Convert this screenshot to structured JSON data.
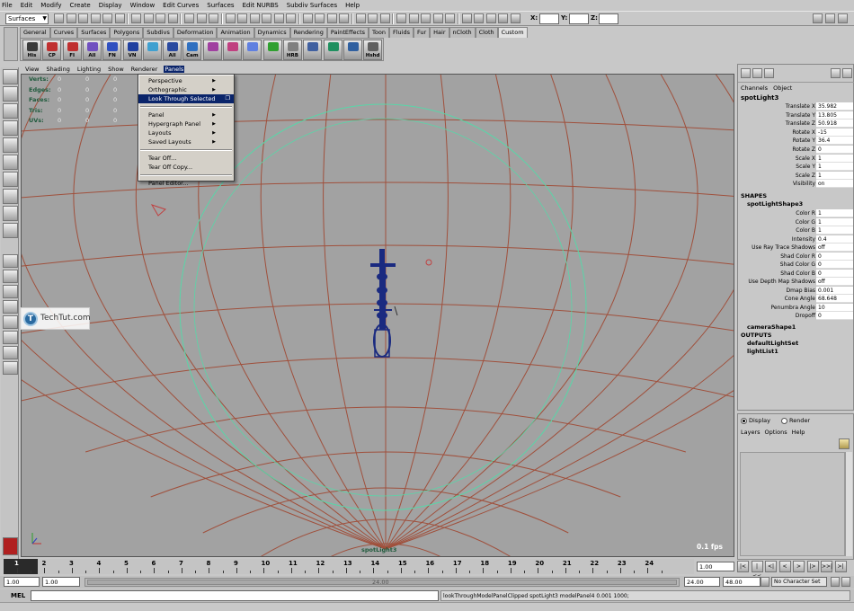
{
  "menubar": [
    "File",
    "Edit",
    "Modify",
    "Create",
    "Display",
    "Window",
    "Edit Curves",
    "Surfaces",
    "Edit NURBS",
    "Subdiv Surfaces",
    "Help"
  ],
  "status": {
    "mode": "Surfaces",
    "coord_labels": [
      "X:",
      "Y:",
      "Z:"
    ]
  },
  "shelf": {
    "tabs": [
      "General",
      "Curves",
      "Surfaces",
      "Polygons",
      "Subdivs",
      "Deformation",
      "Animation",
      "Dynamics",
      "Rendering",
      "PaintEffects",
      "Toon",
      "Fluids",
      "Fur",
      "Hair",
      "nCloth",
      "Cloth",
      "Custom"
    ],
    "active_tab": "Custom",
    "buttons": [
      "His",
      "CP",
      "FI",
      "All",
      "FN",
      "VN",
      "",
      "All",
      "Cam",
      "",
      "",
      "",
      "",
      "HRB",
      "",
      "",
      "",
      "Hshd"
    ]
  },
  "panel_menu": [
    "View",
    "Shading",
    "Lighting",
    "Show",
    "Renderer",
    "Panels"
  ],
  "panel_menu_active": "Panels",
  "panels_dropdown": [
    {
      "label": "Perspective",
      "submenu": true
    },
    {
      "label": "Orthographic",
      "submenu": true
    },
    {
      "label": "Look Through Selected",
      "selected": true,
      "option": true
    },
    {
      "sep": true
    },
    {
      "label": "Panel",
      "submenu": true
    },
    {
      "label": "Hypergraph Panel",
      "submenu": true
    },
    {
      "label": "Layouts",
      "submenu": true
    },
    {
      "label": "Saved Layouts",
      "submenu": true
    },
    {
      "sep": true
    },
    {
      "label": "Tear Off..."
    },
    {
      "label": "Tear Off Copy..."
    },
    {
      "sep": true
    },
    {
      "label": "Panel Editor..."
    }
  ],
  "hud": [
    {
      "label": "Verts:",
      "values": [
        "0",
        "0",
        "0"
      ]
    },
    {
      "label": "Edges:",
      "values": [
        "0",
        "0",
        "0"
      ]
    },
    {
      "label": "Faces:",
      "values": [
        "0",
        "0",
        "0"
      ]
    },
    {
      "label": "Tris:",
      "values": [
        "0",
        "0",
        "0"
      ]
    },
    {
      "label": "UVs:",
      "values": [
        "0",
        "0",
        "0"
      ]
    }
  ],
  "viewport": {
    "fps": "0.1 fps",
    "camera": "spotLight3",
    "grid_color": "#a0503c",
    "circle_color": "#59d6a8",
    "object_color": "#1a2a80"
  },
  "watermark": {
    "logo": "T",
    "text": "TechTut.com"
  },
  "channel_box": {
    "menu": [
      "Channels",
      "Object"
    ],
    "object": "spotLight3",
    "transform": [
      {
        "label": "Translate X",
        "value": "35.982"
      },
      {
        "label": "Translate Y",
        "value": "13.805"
      },
      {
        "label": "Translate Z",
        "value": "50.918"
      },
      {
        "label": "Rotate X",
        "value": "-15"
      },
      {
        "label": "Rotate Y",
        "value": "36.4"
      },
      {
        "label": "Rotate Z",
        "value": "0"
      },
      {
        "label": "Scale X",
        "value": "1"
      },
      {
        "label": "Scale Y",
        "value": "1"
      },
      {
        "label": "Scale Z",
        "value": "1"
      },
      {
        "label": "Visibility",
        "value": "on"
      }
    ],
    "shapes_header": "SHAPES",
    "shape_node": "spotLightShape3",
    "shape_attrs": [
      {
        "label": "Color R",
        "value": "1"
      },
      {
        "label": "Color G",
        "value": "1"
      },
      {
        "label": "Color B",
        "value": "1"
      },
      {
        "label": "Intensity",
        "value": "0.4"
      },
      {
        "label": "Use Ray Trace Shadows",
        "value": "off"
      },
      {
        "label": "Shad Color R",
        "value": "0"
      },
      {
        "label": "Shad Color G",
        "value": "0"
      },
      {
        "label": "Shad Color B",
        "value": "0"
      },
      {
        "label": "Use Depth Map Shadows",
        "value": "off"
      },
      {
        "label": "Dmap Bias",
        "value": "0.001"
      },
      {
        "label": "Cone Angle",
        "value": "68.648"
      },
      {
        "label": "Penumbra Angle",
        "value": "10"
      },
      {
        "label": "Dropoff",
        "value": "0"
      }
    ],
    "extra_shape": "cameraShape1",
    "outputs_header": "OUTPUTS",
    "outputs": [
      "defaultLightSet",
      "lightList1"
    ]
  },
  "layer_editor": {
    "radios": [
      {
        "label": "Display",
        "on": true
      },
      {
        "label": "Render",
        "on": false
      }
    ],
    "menu": [
      "Layers",
      "Options",
      "Help"
    ]
  },
  "timeline": {
    "ticks": [
      "1",
      "2",
      "3",
      "4",
      "5",
      "6",
      "7",
      "8",
      "9",
      "10",
      "11",
      "12",
      "13",
      "14",
      "15",
      "16",
      "17",
      "18",
      "19",
      "20",
      "21",
      "22",
      "23",
      "24"
    ],
    "current": "1.00",
    "playback_buttons": [
      "|<",
      "|<<",
      "<|",
      "<",
      ">",
      "|>",
      ">>|",
      ">|"
    ]
  },
  "range": {
    "start": "1.00",
    "range_start": "1.00",
    "mid": "24.00",
    "range_end": "24.00",
    "end": "48.00",
    "character_set": "No Character Set"
  },
  "command": {
    "label": "MEL",
    "result": "lookThroughModelPanelClipped spotLight3 modelPanel4 0.001 1000;"
  }
}
